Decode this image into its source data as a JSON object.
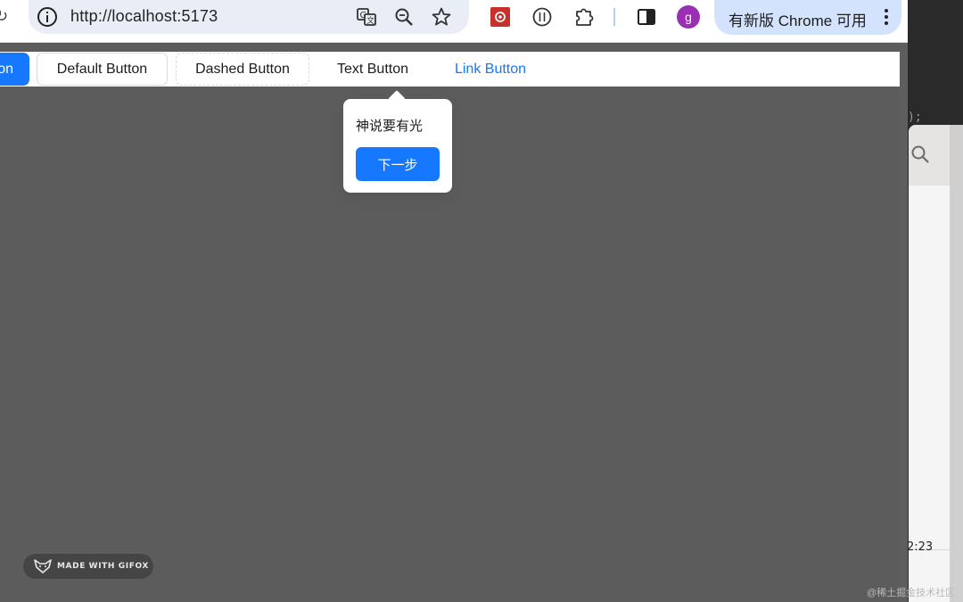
{
  "browser": {
    "url": "http://localhost:5173",
    "update_label": "有新版 Chrome 可用",
    "profile_initial": "g",
    "reload_glyph": "↻",
    "icons": [
      "reload-icon",
      "site-info-icon",
      "translate-icon",
      "zoom-icon",
      "bookmark-star-icon",
      "extension-red-icon",
      "extension-circle-icon",
      "extensions-puzzle-icon",
      "side-panel-icon",
      "more-menu-icon"
    ]
  },
  "page": {
    "buttons": {
      "primary": "on",
      "default": "Default Button",
      "dashed": "Dashed Button",
      "text": "Text Button",
      "link": "Link Button"
    },
    "tour": {
      "description": "神说要有光",
      "next_label": "下一步"
    }
  },
  "watermark": {
    "label": "MADE WITH GIFOX"
  },
  "desktop": {
    "time_partial": "2:23",
    "code_fragment": ");",
    "credit": "@稀土掘金技术社区"
  },
  "colors": {
    "primary": "#1677ff",
    "mask": "rgba(0,0,0,0.64)",
    "omnibox": "#e9eef6",
    "update_pill": "#d3e3fd",
    "avatar": "#9a2fb5"
  }
}
